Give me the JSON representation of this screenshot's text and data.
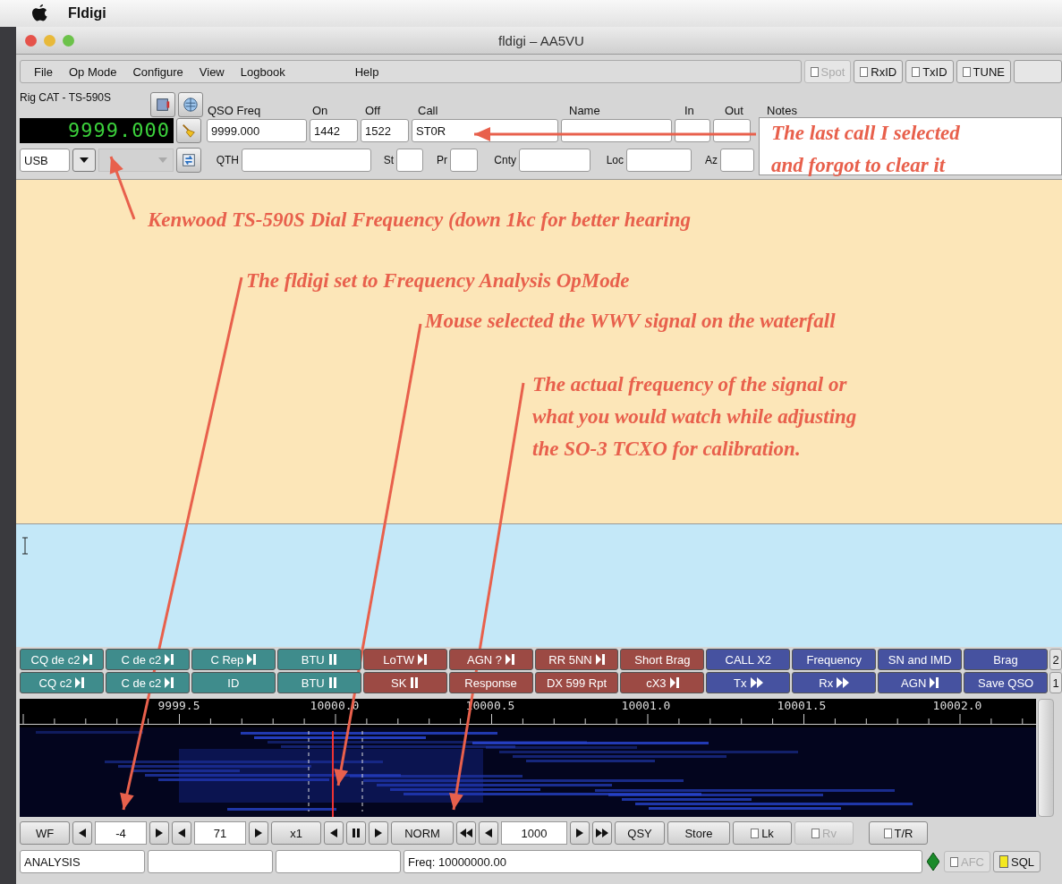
{
  "system_menu": {
    "app": "Fldigi"
  },
  "window": {
    "title": "fldigi – AA5VU"
  },
  "menu": {
    "items": [
      "File",
      "Op Mode",
      "Configure",
      "View",
      "Logbook",
      "Help"
    ],
    "toggles": [
      {
        "label": "Spot",
        "checked": false,
        "disabled": true
      },
      {
        "label": "RxID",
        "checked": false,
        "disabled": false
      },
      {
        "label": "TxID",
        "checked": false,
        "disabled": false
      },
      {
        "label": "TUNE",
        "checked": false,
        "disabled": false
      }
    ]
  },
  "rig": {
    "label": "Rig CAT - TS-590S",
    "frequency": "9999.000",
    "mode": "USB"
  },
  "log_fields": [
    {
      "label": "QSO Freq",
      "value": "9999.000"
    },
    {
      "label": "On",
      "value": "1442"
    },
    {
      "label": "Off",
      "value": "1522"
    },
    {
      "label": "Call",
      "value": "ST0R"
    },
    {
      "label": "Name"
    },
    {
      "label": "In"
    },
    {
      "label": "Out"
    }
  ],
  "notes": {
    "label": "Notes"
  },
  "location_fields": [
    {
      "label": "QTH"
    },
    {
      "label": "St"
    },
    {
      "label": "Pr"
    },
    {
      "label": "Cnty"
    },
    {
      "label": "Loc"
    },
    {
      "label": "Az"
    }
  ],
  "annotations": [
    [
      "The last call I selected",
      "and forgot to clear it"
    ],
    [
      "Kenwood TS-590S Dial Frequency (down 1kc for better hearing"
    ],
    [
      "The fldigi set to Frequency Analysis OpMode"
    ],
    [
      "Mouse selected the WWV signal on the waterfall"
    ],
    [
      "The actual frequency of the signal or",
      "what you would watch while adjusting",
      "the SO-3 TCXO for calibration."
    ]
  ],
  "macros": [
    [
      {
        "label": "CQ de c2",
        "kind": "skip",
        "color": "#3f8c8c"
      },
      {
        "label": "C de c2",
        "kind": "skip",
        "color": "#3f8c8c"
      },
      {
        "label": "C Rep",
        "kind": "skip",
        "color": "#3f8c8c"
      },
      {
        "label": "BTU",
        "kind": "pause",
        "color": "#3f8c8c"
      },
      {
        "label": "LoTW",
        "kind": "skip",
        "color": "#9c4a44"
      },
      {
        "label": "AGN ?",
        "kind": "skip",
        "color": "#9c4a44"
      },
      {
        "label": "RR 5NN",
        "kind": "skip",
        "color": "#9c4a44"
      },
      {
        "label": "Short Brag",
        "kind": "plain",
        "color": "#9c4a44"
      },
      {
        "label": "CALL X2",
        "kind": "plain",
        "color": "#4652a0"
      },
      {
        "label": "Frequency",
        "kind": "plain",
        "color": "#4652a0"
      },
      {
        "label": "SN and IMD",
        "kind": "plain",
        "color": "#4652a0"
      },
      {
        "label": "Brag",
        "kind": "plain",
        "color": "#4652a0"
      },
      {
        "label": "2",
        "kind": "plain",
        "color": "#e4e4e4"
      }
    ],
    [
      {
        "label": "CQ c2",
        "kind": "skip",
        "color": "#3f8c8c"
      },
      {
        "label": "C de c2",
        "kind": "skip",
        "color": "#3f8c8c"
      },
      {
        "label": "ID",
        "kind": "plain",
        "color": "#3f8c8c"
      },
      {
        "label": "BTU",
        "kind": "pause",
        "color": "#3f8c8c"
      },
      {
        "label": "SK",
        "kind": "pause",
        "color": "#9c4a44"
      },
      {
        "label": "Response",
        "kind": "plain",
        "color": "#9c4a44"
      },
      {
        "label": "DX 599 Rpt",
        "kind": "plain",
        "color": "#9c4a44"
      },
      {
        "label": "cX3",
        "kind": "skip",
        "color": "#9c4a44"
      },
      {
        "label": "Tx",
        "kind": "forward",
        "color": "#4652a0"
      },
      {
        "label": "Rx",
        "kind": "forward",
        "color": "#4652a0"
      },
      {
        "label": "AGN",
        "kind": "skip",
        "color": "#4652a0"
      },
      {
        "label": "Save QSO",
        "kind": "plain",
        "color": "#4652a0"
      },
      {
        "label": "1",
        "kind": "plain",
        "color": "#e4e4e4"
      }
    ]
  ],
  "scale_labels": [
    "9999.5",
    "10000.0",
    "10000.5",
    "10001.0",
    "10001.5",
    "10002.0"
  ],
  "controls": [
    {
      "kind": "button",
      "label": "WF"
    },
    {
      "kind": "left"
    },
    {
      "kind": "value",
      "value": "-4"
    },
    {
      "kind": "right"
    },
    {
      "kind": "left"
    },
    {
      "kind": "value",
      "value": "71"
    },
    {
      "kind": "right"
    },
    {
      "kind": "button",
      "label": "x1"
    },
    {
      "kind": "left"
    },
    {
      "kind": "pause"
    },
    {
      "kind": "right"
    },
    {
      "kind": "button",
      "label": "NORM"
    },
    {
      "kind": "rewind"
    },
    {
      "kind": "left"
    },
    {
      "kind": "value",
      "value": "1000"
    },
    {
      "kind": "right"
    },
    {
      "kind": "forward"
    },
    {
      "kind": "button",
      "label": "QSY"
    },
    {
      "kind": "button",
      "label": "Store"
    },
    {
      "kind": "check",
      "label": "Lk",
      "checked": false,
      "disabled": false
    },
    {
      "kind": "check",
      "label": "Rv",
      "checked": false,
      "disabled": true
    },
    {
      "kind": "check",
      "label": "T/R",
      "checked": false,
      "disabled": false
    }
  ],
  "status": {
    "cells": [
      "ANALYSIS",
      "",
      "",
      "Freq: 10000000.00"
    ],
    "afc": {
      "label": "AFC",
      "checked": false,
      "disabled": true
    },
    "sql": {
      "label": "SQL",
      "on": true
    }
  }
}
